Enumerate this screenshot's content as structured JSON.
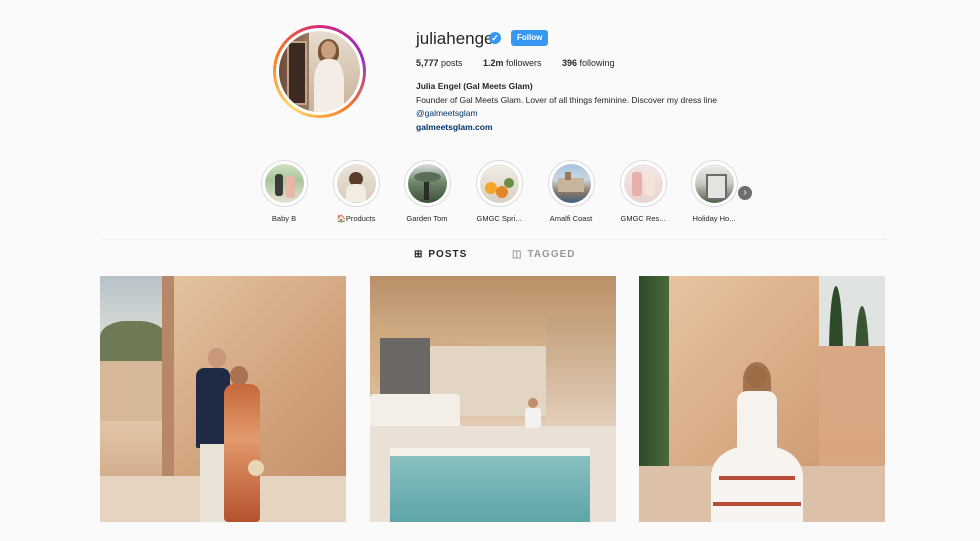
{
  "profile": {
    "username": "juliahengel",
    "follow_label": "Follow",
    "verified_mark": "✓",
    "stats": [
      {
        "value": "5,777",
        "label": "posts"
      },
      {
        "value": "1.2m",
        "label": "followers"
      },
      {
        "value": "396",
        "label": "following"
      }
    ],
    "full_name": "Julia Engel (Gal Meets Glam)",
    "bio": "Founder of Gal Meets Glam. Lover of all things feminine. Discover my dress line",
    "mention": "@galmeetsglam",
    "website": "galmeetsglam.com"
  },
  "highlights": [
    {
      "label": "Baby B"
    },
    {
      "label": "🏠Products"
    },
    {
      "label": "Garden Tom"
    },
    {
      "label": "GMGC Spri..."
    },
    {
      "label": "Amalfi Coast"
    },
    {
      "label": "GMGC Res..."
    },
    {
      "label": "Holiday Ho..."
    }
  ],
  "highlights_next": "›",
  "tabs": {
    "posts": {
      "label": "POSTS",
      "icon": "⊞"
    },
    "tagged": {
      "label": "TAGGED",
      "icon": "◫"
    }
  },
  "colors": {
    "accent": "#3897f0",
    "link": "#003569"
  }
}
